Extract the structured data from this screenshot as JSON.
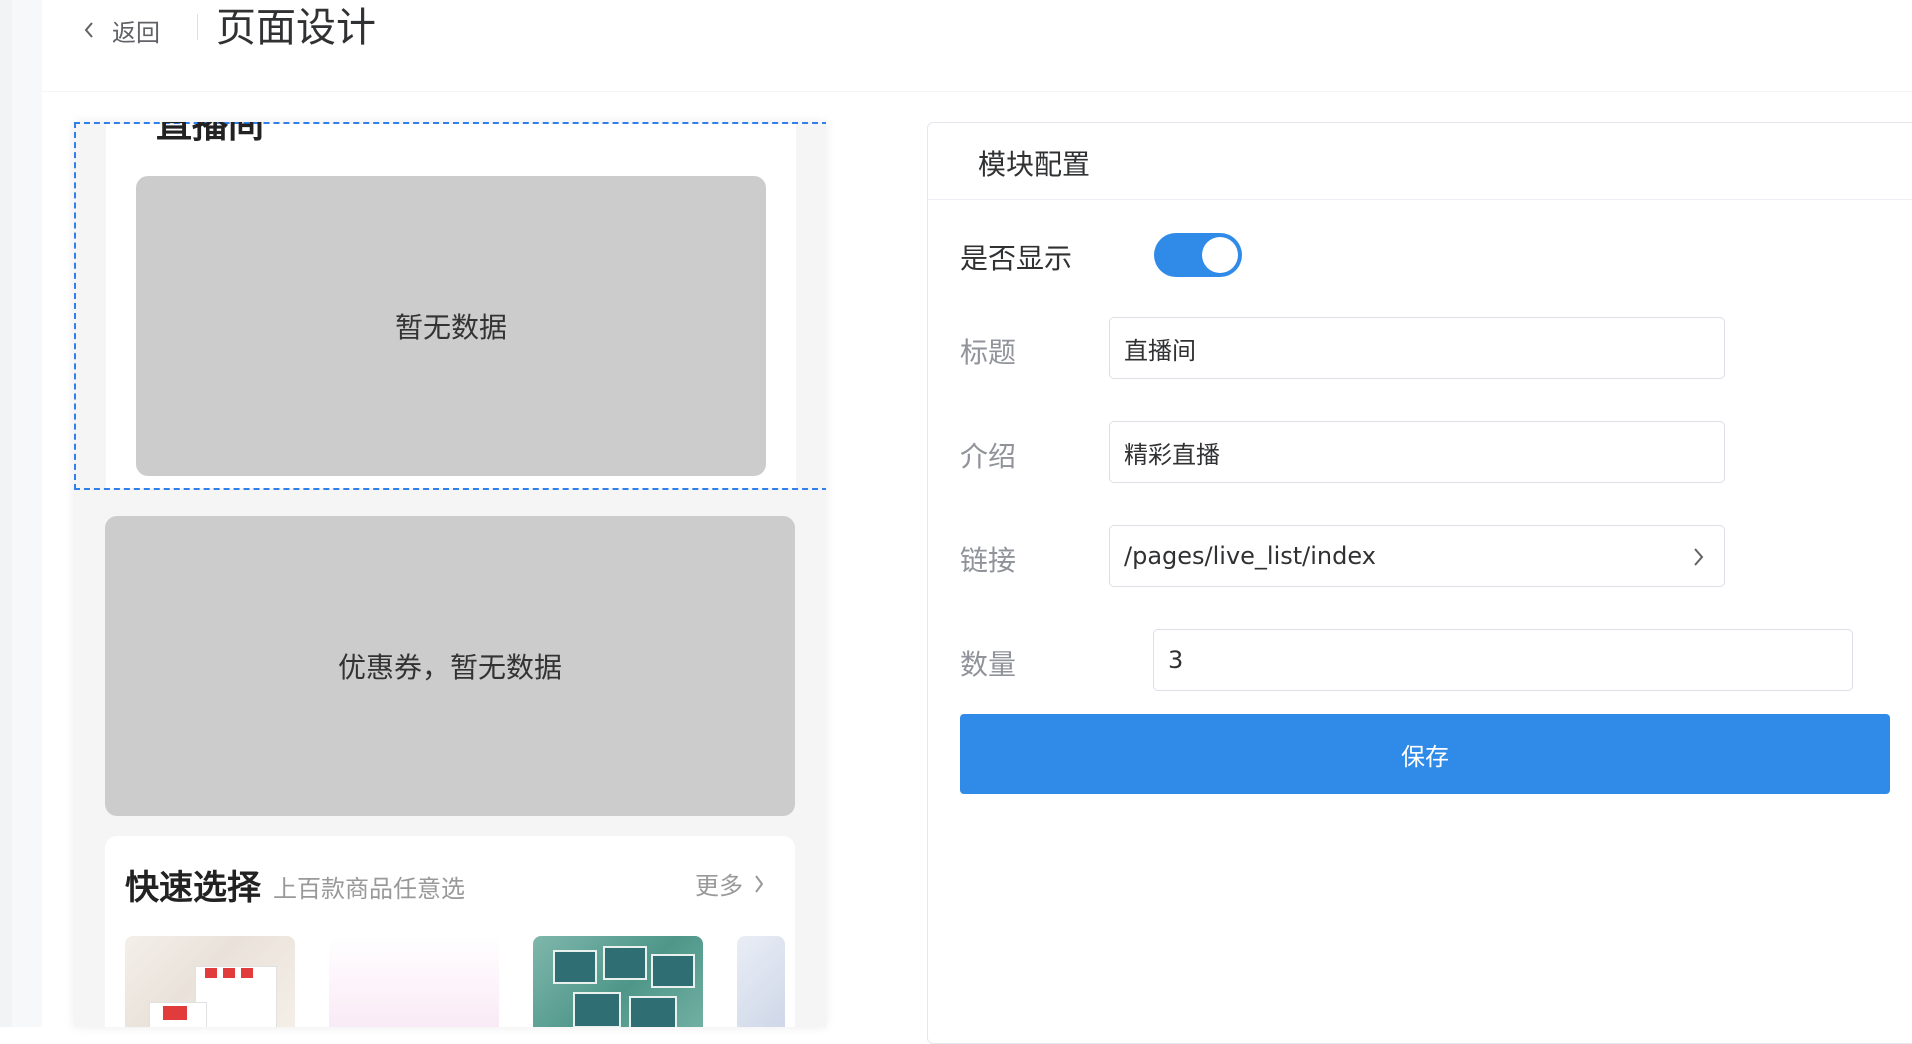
{
  "header": {
    "back_label": "返回",
    "title": "页面设计"
  },
  "preview": {
    "live_module": {
      "title_cut": "直播间",
      "empty_text": "暂无数据"
    },
    "coupon_module": {
      "empty_text": "优惠券，暂无数据"
    },
    "quick_select": {
      "title": "快速选择",
      "subtitle": "上百款商品任意选",
      "more_label": "更多"
    }
  },
  "config": {
    "panel_title": "模块配置",
    "fields": {
      "visible_label": "是否显示",
      "visible_value": true,
      "title_label": "标题",
      "title_value": "直播间",
      "intro_label": "介绍",
      "intro_value": "精彩直播",
      "link_label": "链接",
      "link_value": "/pages/live_list/index",
      "count_label": "数量",
      "count_value": "3"
    },
    "save_label": "保存"
  },
  "colors": {
    "accent": "#2f8ae8",
    "selection_border": "#2f80ed",
    "placeholder_gray": "#cccccc"
  },
  "icons": {
    "back": "chevron-left-icon",
    "more": "chevron-right-icon",
    "link_picker": "chevron-right-icon"
  }
}
